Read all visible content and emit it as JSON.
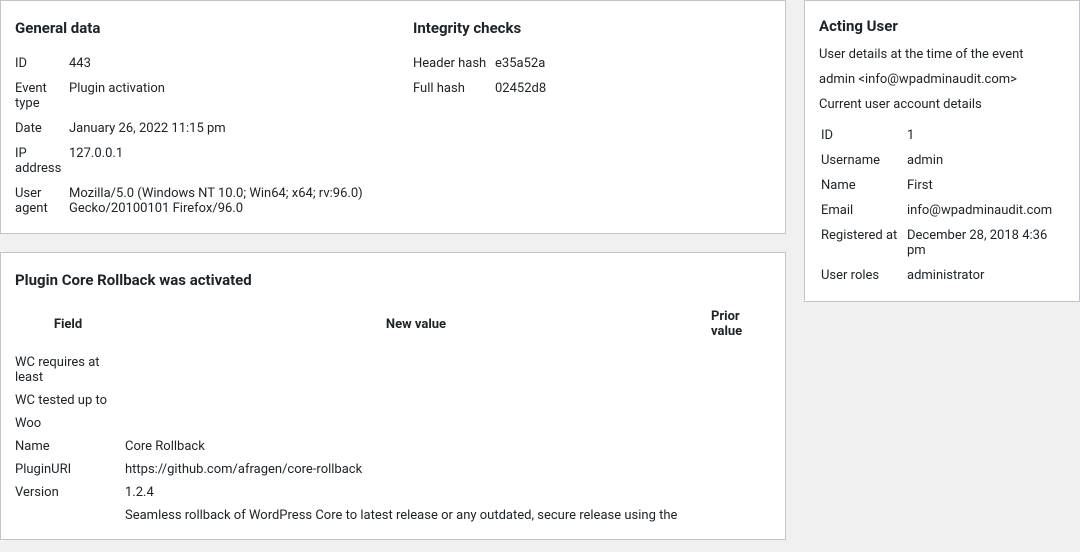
{
  "general": {
    "heading": "General data",
    "rows": [
      {
        "key": "ID",
        "value": "443"
      },
      {
        "key": "Event type",
        "value": "Plugin activation"
      },
      {
        "key": "Date",
        "value": "January 26, 2022 11:15 pm"
      },
      {
        "key": "IP address",
        "value": "127.0.0.1"
      },
      {
        "key": "User agent",
        "value": "Mozilla/5.0 (Windows NT 10.0; Win64; x64; rv:96.0) Gecko/20100101 Firefox/96.0"
      }
    ]
  },
  "integrity": {
    "heading": "Integrity checks",
    "rows": [
      {
        "key": "Header hash",
        "value": "e35a52a"
      },
      {
        "key": "Full hash",
        "value": "02452d8"
      }
    ]
  },
  "acting_user": {
    "heading": "Acting User",
    "time_of_event_label": "User details at the time of the event",
    "identity": "admin <info@wpadminaudit.com>",
    "current_label": "Current user account details",
    "rows": [
      {
        "key": "ID",
        "value": "1"
      },
      {
        "key": "Username",
        "value": "admin"
      },
      {
        "key": "Name",
        "value": "First"
      },
      {
        "key": "Email",
        "value": "info@wpadminaudit.com"
      },
      {
        "key": "Registered at",
        "value": "December 28, 2018 4:36 pm"
      },
      {
        "key": "User roles",
        "value": "administrator"
      }
    ]
  },
  "plugin": {
    "heading": "Plugin Core Rollback was activated",
    "columns": {
      "field": "Field",
      "new": "New value",
      "prior": "Prior value"
    },
    "rows": [
      {
        "field": "WC requires at least",
        "new": "",
        "prior": ""
      },
      {
        "field": "WC tested up to",
        "new": "",
        "prior": ""
      },
      {
        "field": "Woo",
        "new": "",
        "prior": ""
      },
      {
        "field": "Name",
        "new": "Core Rollback",
        "prior": ""
      },
      {
        "field": "PluginURI",
        "new": "https://github.com/afragen/core-rollback",
        "prior": ""
      },
      {
        "field": "Version",
        "new": "1.2.4",
        "prior": ""
      },
      {
        "field": "",
        "new": "Seamless rollback of WordPress Core to latest release or any outdated, secure release using the",
        "prior": ""
      }
    ]
  }
}
